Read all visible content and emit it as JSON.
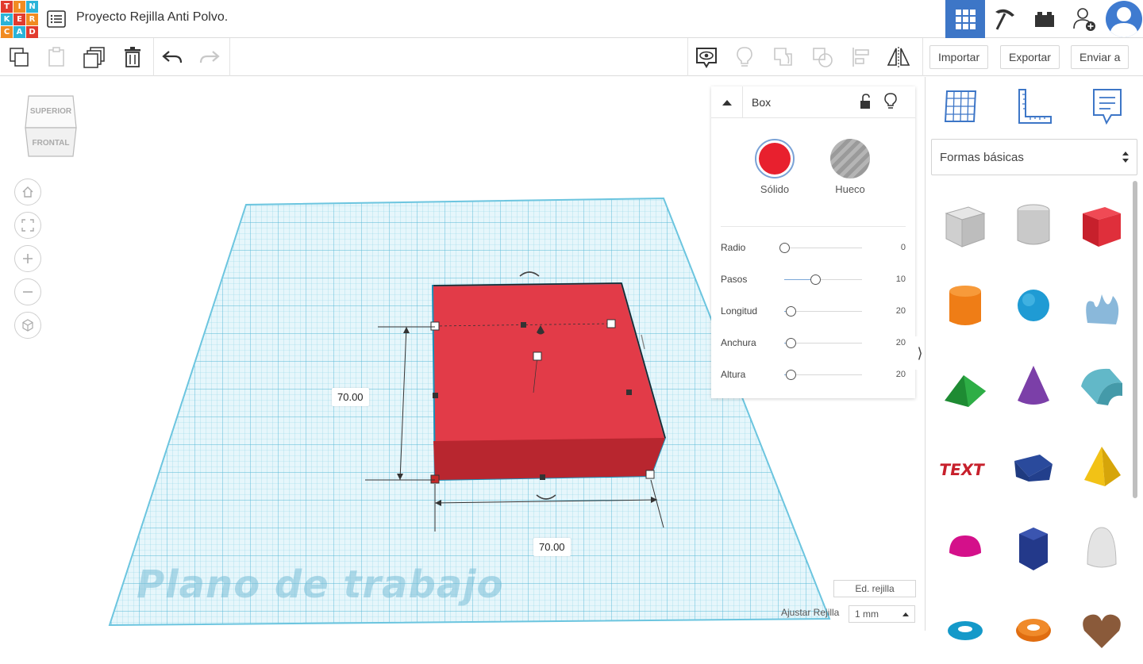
{
  "app": {
    "logo_letters": [
      "T",
      "I",
      "N",
      "K",
      "E",
      "R",
      "C",
      "A",
      "D"
    ],
    "logo_colors": [
      "#e23b2e",
      "#f18b21",
      "#2bb3d8",
      "#2bb3d8",
      "#e23b2e",
      "#f18b21",
      "#f18b21",
      "#2bb3d8",
      "#e23b2e"
    ],
    "project_title": "Proyecto Rejilla Anti Polvo.",
    "accent_color": "#3d76c7"
  },
  "toolbar": {
    "left_tools": [
      "copy-icon",
      "paste-icon",
      "duplicate-icon",
      "delete-icon",
      "undo-icon",
      "redo-icon"
    ],
    "right_tools": [
      "view-notes-icon",
      "light-bulb-icon",
      "group-icon",
      "ungroup-icon",
      "align-icon",
      "mirror-icon"
    ],
    "import_label": "Importar",
    "export_label": "Exportar",
    "send_label": "Enviar a"
  },
  "viewcube": {
    "top_label": "SUPERIOR",
    "front_label": "FRONTAL"
  },
  "nav_controls": [
    "home-icon",
    "fit-view-icon",
    "zoom-in-icon",
    "zoom-out-icon",
    "ortho-view-icon"
  ],
  "workspace": {
    "dim_height": "70.00",
    "dim_width": "70.00",
    "workplane_label": "Plano de trabajo",
    "edit_grid_label": "Ed. rejilla",
    "snap_label": "Ajustar Rejilla",
    "snap_value": "1 mm",
    "grid_color": "#8fd3e6",
    "shape_color": "#e23b48"
  },
  "inspector": {
    "title": "Box",
    "solid_label": "Sólido",
    "hole_label": "Hueco",
    "solid_color": "#e8202e",
    "params": [
      {
        "label": "Radio",
        "value": "0",
        "level": 0.0
      },
      {
        "label": "Pasos",
        "value": "10",
        "level": 0.4
      },
      {
        "label": "Longitud",
        "value": "20",
        "level": 0.08
      },
      {
        "label": "Anchura",
        "value": "20",
        "level": 0.08
      },
      {
        "label": "Altura",
        "value": "20",
        "level": 0.08
      }
    ]
  },
  "right_panel": {
    "tabs": [
      "grid-view-icon",
      "ruler-icon",
      "notes-icon"
    ],
    "library_label": "Formas básicas",
    "shapes": [
      "box-hole",
      "cylinder-hole",
      "box",
      "cylinder",
      "sphere",
      "scribble",
      "roof",
      "cone",
      "round-roof",
      "text",
      "wedge",
      "pyramid",
      "half-sphere",
      "polygon",
      "paraboloid",
      "torus",
      "tube",
      "heart"
    ]
  }
}
